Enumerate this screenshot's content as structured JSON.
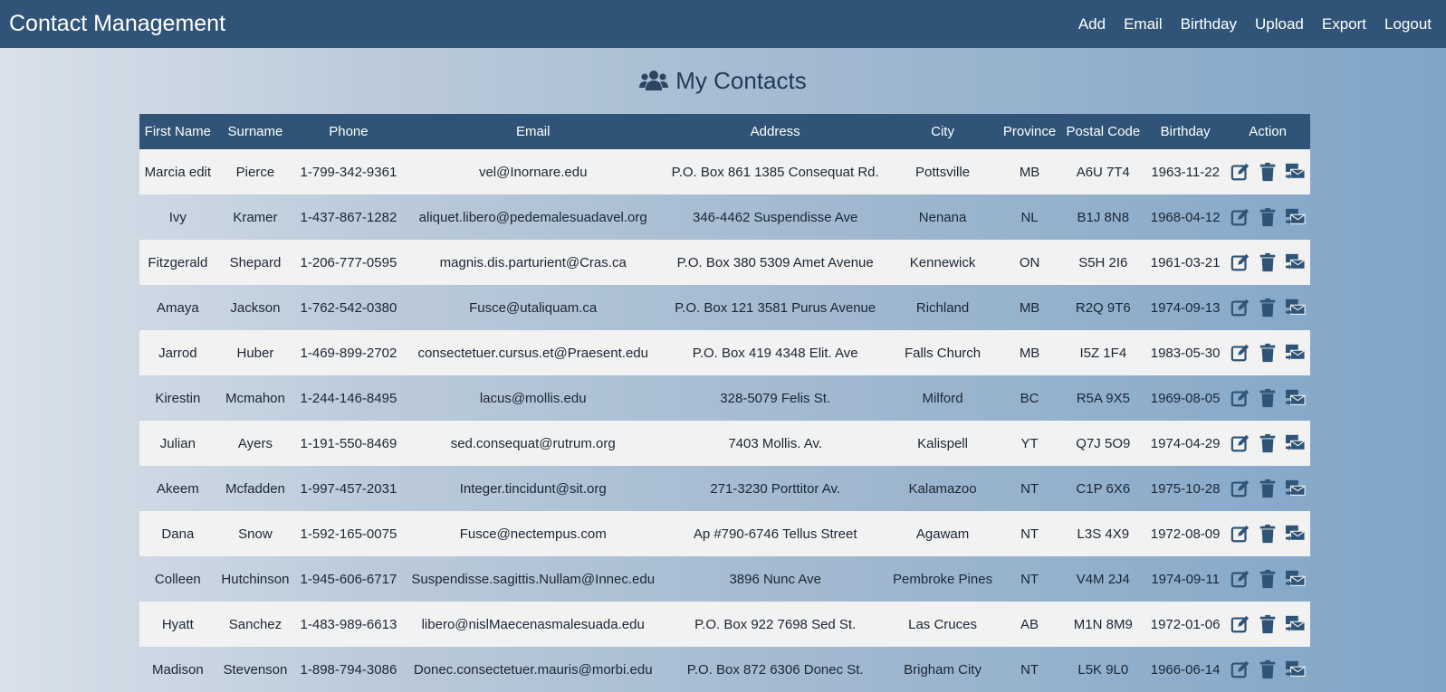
{
  "app": {
    "title": "Contact Management"
  },
  "nav": [
    "Add",
    "Email",
    "Birthday",
    "Upload",
    "Export",
    "Logout"
  ],
  "page": {
    "heading": "My Contacts",
    "heading_icon": "users-icon"
  },
  "table": {
    "headers": [
      "First Name",
      "Surname",
      "Phone",
      "Email",
      "Address",
      "City",
      "Province",
      "Postal Code",
      "Birthday",
      "Action"
    ],
    "action_icons": [
      "edit-icon",
      "trash-icon",
      "mail-transfer-icon"
    ],
    "rows": [
      [
        "Marcia edit",
        "Pierce",
        "1-799-342-9361",
        "vel@Inornare.edu",
        "P.O. Box 861 1385 Consequat Rd.",
        "Pottsville",
        "MB",
        "A6U 7T4",
        "1963-11-22"
      ],
      [
        "Ivy",
        "Kramer",
        "1-437-867-1282",
        "aliquet.libero@pedemalesuadavel.org",
        "346-4462 Suspendisse Ave",
        "Nenana",
        "NL",
        "B1J 8N8",
        "1968-04-12"
      ],
      [
        "Fitzgerald",
        "Shepard",
        "1-206-777-0595",
        "magnis.dis.parturient@Cras.ca",
        "P.O. Box 380 5309 Amet Avenue",
        "Kennewick",
        "ON",
        "S5H 2I6",
        "1961-03-21"
      ],
      [
        "Amaya",
        "Jackson",
        "1-762-542-0380",
        "Fusce@utaliquam.ca",
        "P.O. Box 121 3581 Purus Avenue",
        "Richland",
        "MB",
        "R2Q 9T6",
        "1974-09-13"
      ],
      [
        "Jarrod",
        "Huber",
        "1-469-899-2702",
        "consectetuer.cursus.et@Praesent.edu",
        "P.O. Box 419 4348 Elit. Ave",
        "Falls Church",
        "MB",
        "I5Z 1F4",
        "1983-05-30"
      ],
      [
        "Kirestin",
        "Mcmahon",
        "1-244-146-8495",
        "lacus@mollis.edu",
        "328-5079 Felis St.",
        "Milford",
        "BC",
        "R5A 9X5",
        "1969-08-05"
      ],
      [
        "Julian",
        "Ayers",
        "1-191-550-8469",
        "sed.consequat@rutrum.org",
        "7403 Mollis. Av.",
        "Kalispell",
        "YT",
        "Q7J 5O9",
        "1974-04-29"
      ],
      [
        "Akeem",
        "Mcfadden",
        "1-997-457-2031",
        "Integer.tincidunt@sit.org",
        "271-3230 Porttitor Av.",
        "Kalamazoo",
        "NT",
        "C1P 6X6",
        "1975-10-28"
      ],
      [
        "Dana",
        "Snow",
        "1-592-165-0075",
        "Fusce@nectempus.com",
        "Ap #790-6746 Tellus Street",
        "Agawam",
        "NT",
        "L3S 4X9",
        "1972-08-09"
      ],
      [
        "Colleen",
        "Hutchinson",
        "1-945-606-6717",
        "Suspendisse.sagittis.Nullam@Innec.edu",
        "3896 Nunc Ave",
        "Pembroke Pines",
        "NT",
        "V4M 2J4",
        "1974-09-11"
      ],
      [
        "Hyatt",
        "Sanchez",
        "1-483-989-6613",
        "libero@nislMaecenasmalesuada.edu",
        "P.O. Box 922 7698 Sed St.",
        "Las Cruces",
        "AB",
        "M1N 8M9",
        "1972-01-06"
      ],
      [
        "Madison",
        "Stevenson",
        "1-898-794-3086",
        "Donec.consectetuer.mauris@morbi.edu",
        "P.O. Box 872 6306 Donec St.",
        "Brigham City",
        "NT",
        "L5K 9L0",
        "1966-06-14"
      ]
    ]
  }
}
